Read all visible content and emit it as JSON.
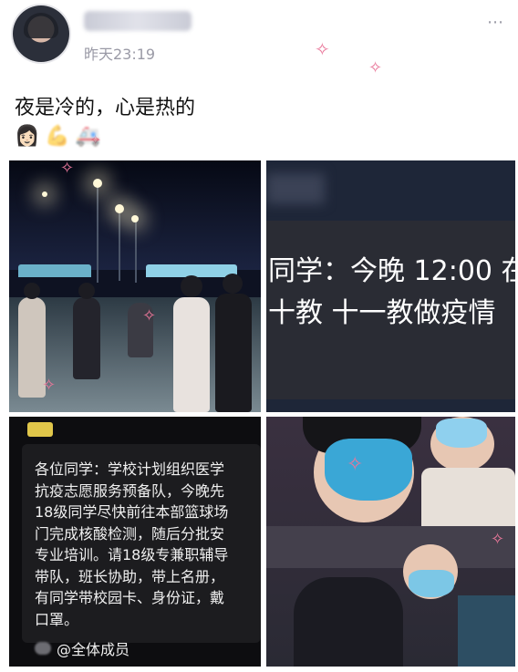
{
  "post": {
    "time": "昨天23:19",
    "caption": "夜是冷的，心是热的",
    "more_icon": "⋯",
    "emojis": [
      "👩🏻",
      "💪",
      "🚑"
    ]
  },
  "images": {
    "tile2": {
      "line1": "同学：今晚 12:00 在",
      "line2": "十教 十一教做疫情"
    },
    "tile3": {
      "lines": [
        "各位同学：学校计划组织医学",
        "抗疫志愿服务预备队，今晚先",
        "18级同学尽快前往本部篮球场",
        "门完成核酸检测，随后分批安",
        "专业培训。请18级专兼职辅导",
        "带队，班长协助，带上名册，",
        "有同学带校园卡、身份证，戴",
        "口罩。"
      ],
      "mention": "@全体成员"
    }
  },
  "colors": {
    "accent": "#e9779a",
    "time": "#9a9aa6"
  }
}
